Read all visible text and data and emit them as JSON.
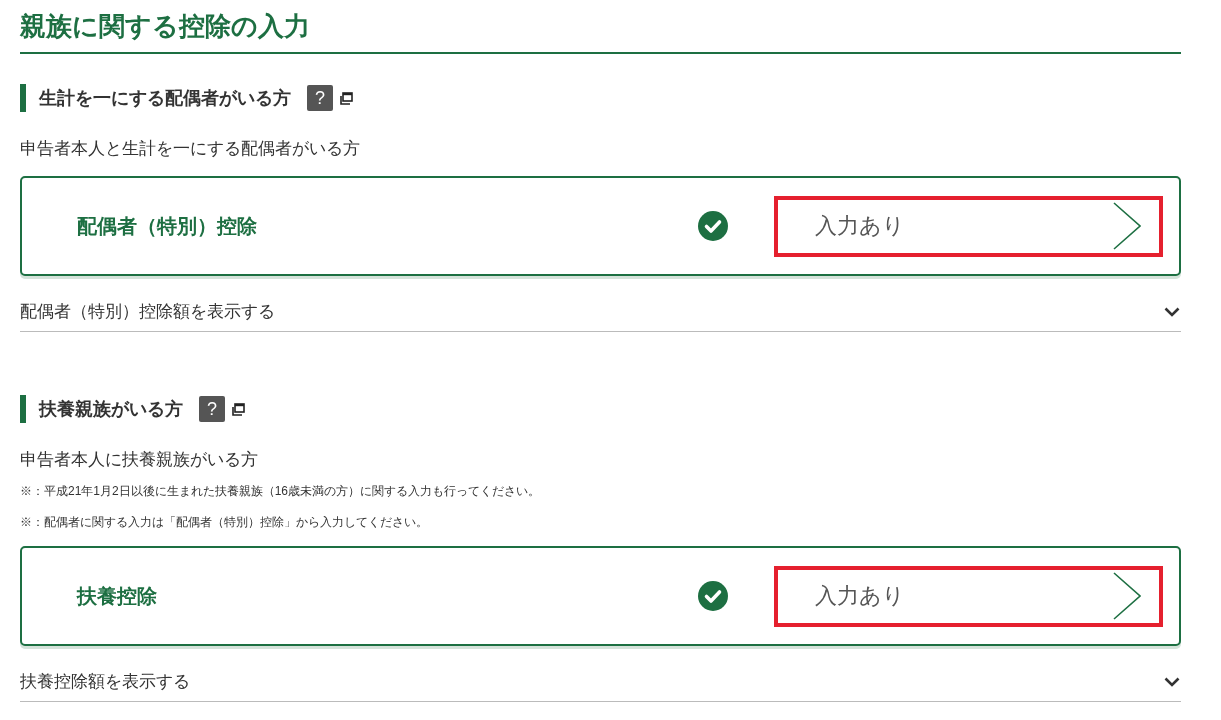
{
  "page_title": "親族に関する控除の入力",
  "sections": [
    {
      "heading": "生計を一にする配偶者がいる方",
      "help_label": "?",
      "description": "申告者本人と生計を一にする配偶者がいる方",
      "card": {
        "title": "配偶者（特別）控除",
        "completed": true,
        "status": "入力あり",
        "highlighted": true
      },
      "expander": {
        "label": "配偶者（特別）控除額を表示する",
        "expanded": false
      }
    },
    {
      "heading": "扶養親族がいる方",
      "help_label": "?",
      "description": "申告者本人に扶養親族がいる方",
      "notes": [
        "※：平成21年1月2日以後に生まれた扶養親族（16歳未満の方）に関する入力も行ってください。",
        "※：配偶者に関する入力は「配偶者（特別）控除」から入力してください。"
      ],
      "card": {
        "title": "扶養控除",
        "completed": true,
        "status": "入力あり",
        "highlighted": true
      },
      "expander": {
        "label": "扶養控除額を表示する",
        "expanded": false
      }
    }
  ]
}
